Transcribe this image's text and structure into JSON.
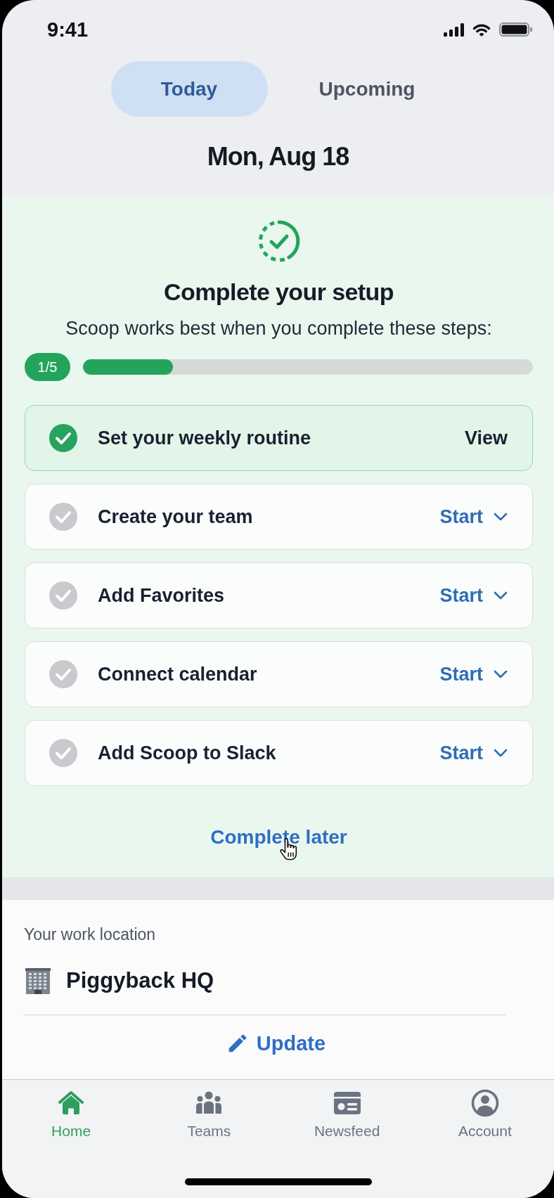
{
  "status_bar": {
    "time": "9:41"
  },
  "tabs": [
    {
      "label": "Today",
      "selected": true
    },
    {
      "label": "Upcoming",
      "selected": false
    }
  ],
  "date": "Mon, Aug 18",
  "setup": {
    "title": "Complete your setup",
    "subtitle": "Scoop works best when you complete these steps:",
    "progress": {
      "count": "1/5",
      "level": 0.2
    },
    "steps": [
      {
        "label": "Set your weekly routine",
        "done": true,
        "action": "View"
      },
      {
        "label": "Create your team",
        "done": false,
        "action": "Start"
      },
      {
        "label": "Add Favorites",
        "done": false,
        "action": "Start"
      },
      {
        "label": "Connect calendar",
        "done": false,
        "action": "Start"
      },
      {
        "label": "Add Scoop to Slack",
        "done": false,
        "action": "Start"
      }
    ],
    "complete_later": "Complete later"
  },
  "work_location": {
    "heading": "Your work location",
    "name": "Piggyback HQ",
    "update": "Update"
  },
  "bottom_nav": [
    {
      "label": "Home",
      "selected": true
    },
    {
      "label": "Teams",
      "selected": false
    },
    {
      "label": "Newsfeed",
      "selected": false
    },
    {
      "label": "Account",
      "selected": false
    }
  ]
}
